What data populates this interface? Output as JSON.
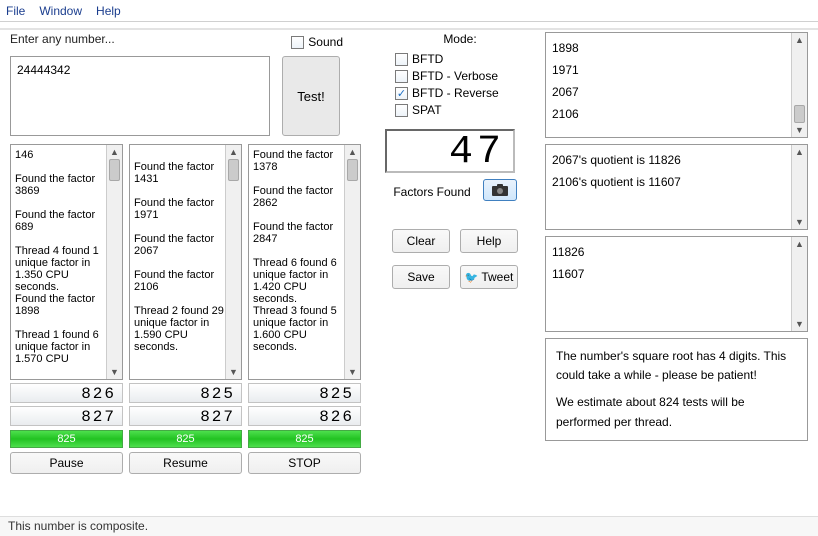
{
  "menu": {
    "file": "File",
    "window": "Window",
    "help": "Help"
  },
  "input": {
    "label": "Enter any number...",
    "value": "24444342"
  },
  "sound": {
    "label": "Sound",
    "checked": false
  },
  "test_button": "Test!",
  "mode": {
    "title": "Mode:",
    "options": [
      {
        "label": "BFTD",
        "checked": false
      },
      {
        "label": "BFTD - Verbose",
        "checked": false
      },
      {
        "label": "BFTD - Reverse",
        "checked": true
      },
      {
        "label": "SPAT",
        "checked": false
      }
    ]
  },
  "threads": [
    {
      "text": "146\n\nFound the factor 3869\n\nFound the factor 689\n\nThread 4 found 1 unique factor in 1.350 CPU seconds.\nFound the factor 1898\n\nThread 1 found 6 unique factor in 1.570 CPU",
      "segA": "826",
      "segB": "827",
      "progress": "825"
    },
    {
      "text": "\nFound the factor 1431\n\nFound the factor 1971\n\nFound the factor 2067\n\nFound the factor 2106\n\nThread 2 found 29 unique factor in 1.590 CPU seconds.",
      "segA": "825",
      "segB": "827",
      "progress": "825"
    },
    {
      "text": "Found the factor 1378\n\nFound the factor 2862\n\nFound the factor 2847\n\nThread 6 found 6 unique factor in 1.420 CPU seconds.\nThread 3 found 5 unique factor in 1.600 CPU seconds.",
      "segA": "825",
      "segB": "826",
      "progress": "825"
    }
  ],
  "thread_buttons": [
    "Pause",
    "Resume",
    "STOP"
  ],
  "factors": {
    "display": "47",
    "label": "Factors Found"
  },
  "actions": {
    "clear": "Clear",
    "help": "Help",
    "save": "Save",
    "tweet": "Tweet"
  },
  "right_lists": {
    "factors_list": [
      "1898",
      "1971",
      "2067",
      "2106"
    ],
    "quotients_text": [
      "2067's quotient is 11826",
      "2106's quotient is 11607"
    ],
    "quotients_list": [
      "11826",
      "11607"
    ]
  },
  "bottom_info": {
    "line1": "The number's square root has 4 digits. This could take a while - please be patient!",
    "line2": "We estimate about 824 tests will be performed per thread."
  },
  "status": "This number is composite."
}
